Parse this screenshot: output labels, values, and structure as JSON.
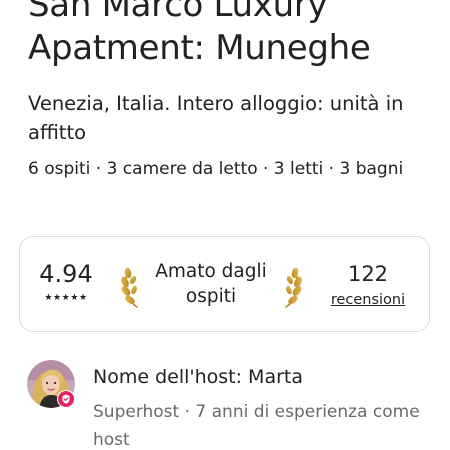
{
  "listing": {
    "title": "San Marco Luxury Apatment: Muneghe",
    "subtitle": "Venezia, Italia. Intero alloggio: unità in affitto",
    "details": "6 ospiti · 3 camere da letto · 3 letti · 3 bagni"
  },
  "rating": {
    "score": "4.94",
    "stars": "★★★★★",
    "badge_text": "Amato dagli ospiti",
    "laurel_icon": "laurel-icon",
    "reviews_count": "122",
    "reviews_label": "recensioni"
  },
  "host": {
    "name_line": "Nome dell'host: Marta",
    "meta": "Superhost · 7 anni di esperienza come host",
    "avatar_icon": "host-avatar",
    "badge_icon": "superhost-badge-icon",
    "badge_color": "#e0245e"
  },
  "colors": {
    "text": "#222222",
    "secondary_text": "#6a6a6a",
    "card_border": "#dddddd",
    "laurel_gold": "#c89b2a"
  }
}
